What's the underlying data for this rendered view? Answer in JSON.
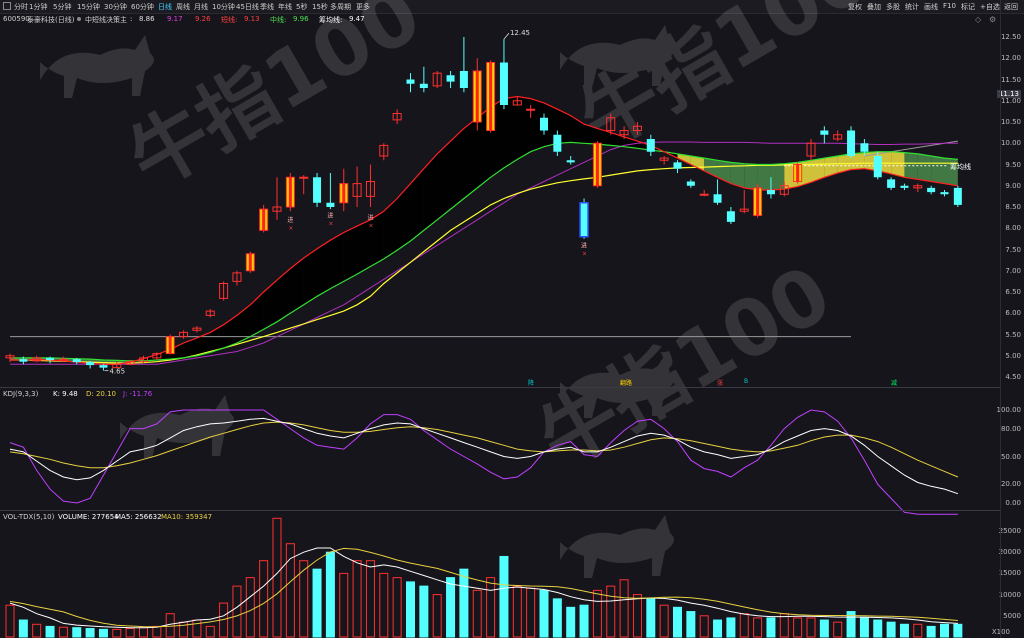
{
  "toolbar": {
    "left_icon": "panel-toggle-icon",
    "periods": [
      "分时",
      "1分钟",
      "5分钟",
      "15分钟",
      "30分钟",
      "60分钟",
      "日线",
      "周线",
      "月线",
      "10分钟",
      "45日线",
      "季线",
      "年线",
      "5秒",
      "15秒",
      "多周期",
      "更多"
    ],
    "active_period": "日线",
    "right_buttons": [
      "复权",
      "叠加",
      "多股",
      "统计",
      "画线",
      "F10",
      "标记",
      "+自选",
      "返回"
    ]
  },
  "stock": {
    "code": "600590",
    "name": "泰豪科技(日线)"
  },
  "indicator_main": {
    "name": "中短线决策主",
    "values": [
      {
        "label": ":",
        "value": "8.86",
        "color": "#e0e0e0"
      },
      {
        "label": "",
        "value": "9.17",
        "color": "#e040e0"
      },
      {
        "label": "",
        "value": "9.26",
        "color": "#ff4040"
      },
      {
        "label": "短线:",
        "value": "9.13",
        "color": "#ff4040"
      },
      {
        "label": "中线:",
        "value": "9.96",
        "color": "#50e050"
      },
      {
        "label": "筹均线:",
        "value": "9.47",
        "color": "#ffffff"
      }
    ]
  },
  "price_axis": [
    "12.50",
    "12.00",
    "11.50",
    "11.00",
    "10.50",
    "10.00",
    "9.50",
    "9.00",
    "8.50",
    "8.00",
    "7.50",
    "7.00",
    "6.50",
    "6.00",
    "5.50",
    "5.00",
    "4.50"
  ],
  "current_price_tag": "11.13",
  "high_label": "12.45",
  "low_label": "4.65",
  "line_label": "筹均线",
  "signals": [
    {
      "text": "降",
      "color": "#00c8c8"
    },
    {
      "text": "翻路",
      "color": "#ffcc00"
    },
    {
      "text": "涨",
      "color": "#ff4040"
    },
    {
      "text": "B",
      "color": "#00c8c8"
    },
    {
      "text": "减",
      "color": "#00ff60"
    }
  ],
  "candle_markers": [
    "进",
    "进",
    "进",
    "进"
  ],
  "kdj": {
    "name": "KDJ(9,3,3)",
    "k": "K: 9.48",
    "d": "D: 20.10",
    "j": "J: -11.76",
    "axis": [
      "100.00",
      "80.00",
      "50.00",
      "20.00",
      "0.00"
    ]
  },
  "volume": {
    "name": "VOL-TDX(5,10)",
    "vol": "VOLUME: 277654",
    "ma5": "MA5: 256632",
    "ma10": "MA10: 359347",
    "axis": [
      "25000",
      "20000",
      "15000",
      "10000",
      "5000"
    ],
    "unit": "X100"
  },
  "watermark": {
    "text": "牛指100",
    "icon": "bull-silhouette-icon"
  },
  "colors": {
    "up": "#ff3030",
    "down": "#54ffff",
    "k_line": "#ffffff",
    "d_line": "#e8d040",
    "j_line": "#c040ff",
    "ma5": "#ffffff",
    "ma10": "#e8d040"
  },
  "chart_data": {
    "type": "candlestick",
    "y_unit": "CNY",
    "ylim": [
      4.5,
      12.5
    ],
    "candles": [
      [
        4.95,
        5.0,
        5.05,
        4.85
      ],
      [
        4.92,
        4.86,
        4.98,
        4.8
      ],
      [
        4.88,
        4.95,
        5.0,
        4.85
      ],
      [
        4.95,
        4.9,
        4.98,
        4.82
      ],
      [
        4.9,
        4.92,
        4.98,
        4.85
      ],
      [
        4.92,
        4.85,
        4.95,
        4.8
      ],
      [
        4.85,
        4.78,
        4.88,
        4.7
      ],
      [
        4.78,
        4.72,
        4.8,
        4.65
      ],
      [
        4.72,
        4.8,
        4.85,
        4.7
      ],
      [
        4.8,
        4.86,
        4.9,
        4.78
      ],
      [
        4.86,
        4.95,
        5.0,
        4.82
      ],
      [
        4.95,
        5.05,
        5.08,
        4.9
      ],
      [
        5.05,
        5.45,
        5.5,
        5.05
      ],
      [
        5.45,
        5.55,
        5.6,
        5.4
      ],
      [
        5.6,
        5.65,
        5.7,
        5.55
      ],
      [
        5.95,
        6.05,
        6.1,
        5.9
      ],
      [
        6.35,
        6.7,
        6.75,
        6.3
      ],
      [
        6.75,
        6.95,
        7.0,
        6.65
      ],
      [
        7.0,
        7.4,
        7.45,
        6.95
      ],
      [
        7.95,
        8.45,
        8.55,
        7.9
      ],
      [
        8.4,
        8.5,
        9.2,
        8.2
      ],
      [
        8.5,
        9.2,
        9.3,
        8.4
      ],
      [
        9.2,
        9.2,
        9.25,
        8.8
      ],
      [
        9.2,
        8.6,
        9.3,
        8.5
      ],
      [
        8.6,
        8.5,
        9.3,
        8.45
      ],
      [
        8.6,
        9.05,
        9.4,
        8.4
      ],
      [
        8.75,
        9.05,
        9.45,
        8.5
      ],
      [
        8.75,
        9.1,
        9.5,
        8.5
      ],
      [
        9.7,
        9.95,
        10.0,
        9.6
      ],
      [
        10.55,
        10.7,
        10.8,
        10.45
      ],
      [
        11.5,
        11.4,
        11.65,
        11.2
      ],
      [
        11.4,
        11.3,
        11.8,
        11.2
      ],
      [
        11.35,
        11.65,
        11.7,
        11.3
      ],
      [
        11.6,
        11.45,
        11.7,
        11.3
      ],
      [
        11.7,
        11.3,
        12.5,
        11.2
      ],
      [
        10.5,
        11.7,
        12.0,
        10.3
      ],
      [
        10.3,
        11.9,
        11.95,
        10.25
      ],
      [
        11.9,
        10.9,
        12.45,
        10.8
      ],
      [
        10.9,
        11.0,
        11.1,
        10.9
      ],
      [
        10.8,
        10.8,
        10.9,
        10.6
      ],
      [
        10.6,
        10.3,
        10.7,
        10.2
      ],
      [
        10.2,
        9.8,
        10.3,
        9.7
      ],
      [
        9.6,
        9.55,
        9.7,
        9.5
      ],
      [
        8.6,
        7.8,
        8.7,
        7.75
      ],
      [
        9.0,
        10.0,
        10.05,
        8.95
      ],
      [
        10.3,
        10.6,
        10.7,
        10.2
      ],
      [
        10.2,
        10.3,
        10.4,
        10.1
      ],
      [
        10.3,
        10.4,
        10.5,
        10.2
      ],
      [
        10.1,
        9.8,
        10.2,
        9.7
      ],
      [
        9.6,
        9.65,
        9.7,
        9.5
      ],
      [
        9.55,
        9.4,
        9.6,
        9.3
      ],
      [
        9.1,
        9.0,
        9.15,
        8.95
      ],
      [
        8.8,
        8.8,
        8.9,
        8.75
      ],
      [
        8.8,
        8.6,
        9.15,
        8.55
      ],
      [
        8.4,
        8.15,
        8.5,
        8.1
      ],
      [
        8.4,
        8.45,
        8.9,
        8.35
      ],
      [
        8.3,
        8.95,
        9.05,
        8.25
      ],
      [
        8.9,
        8.8,
        9.2,
        8.7
      ],
      [
        8.8,
        9.0,
        9.1,
        8.75
      ],
      [
        9.1,
        9.5,
        9.55,
        9.05
      ],
      [
        9.7,
        10.0,
        10.1,
        9.6
      ],
      [
        10.3,
        10.2,
        10.4,
        10.0
      ],
      [
        10.1,
        10.2,
        10.3,
        10.05
      ],
      [
        10.3,
        9.7,
        10.4,
        9.65
      ],
      [
        10.0,
        9.8,
        10.1,
        9.7
      ],
      [
        9.7,
        9.2,
        9.8,
        9.15
      ],
      [
        9.15,
        8.95,
        9.2,
        8.9
      ],
      [
        9.0,
        8.95,
        9.05,
        8.9
      ],
      [
        8.95,
        9.0,
        9.05,
        8.85
      ],
      [
        8.95,
        8.85,
        9.0,
        8.8
      ],
      [
        8.85,
        8.8,
        8.9,
        8.75
      ],
      [
        8.95,
        8.55,
        9.0,
        8.5
      ]
    ],
    "series": [
      {
        "name": "短线",
        "values": [
          4.9,
          4.9,
          4.91,
          4.9,
          4.88,
          4.85,
          4.82,
          4.8,
          4.8,
          4.85,
          4.93,
          5.03,
          5.15,
          5.3,
          5.42,
          5.55,
          5.73,
          5.95,
          6.2,
          6.5,
          6.78,
          7.05,
          7.3,
          7.52,
          7.72,
          7.9,
          8.05,
          8.2,
          8.4,
          8.7,
          9.05,
          9.4,
          9.75,
          10.05,
          10.35,
          10.6,
          10.85,
          11.05,
          11.1,
          11.05,
          10.95,
          10.8,
          10.65,
          10.45,
          10.35,
          10.25,
          10.15,
          10.05,
          9.95,
          9.8,
          9.65,
          9.5,
          9.35,
          9.2,
          9.05,
          8.95,
          8.9,
          8.9,
          8.92,
          8.98,
          9.08,
          9.2,
          9.3,
          9.38,
          9.4,
          9.35,
          9.28,
          9.2,
          9.15,
          9.1,
          9.05,
          9.0
        ]
      },
      {
        "name": "中线",
        "values": [
          4.95,
          4.95,
          4.95,
          4.95,
          4.94,
          4.93,
          4.92,
          4.9,
          4.89,
          4.88,
          4.88,
          4.9,
          4.92,
          4.95,
          5.0,
          5.08,
          5.18,
          5.3,
          5.45,
          5.62,
          5.8,
          6.0,
          6.2,
          6.4,
          6.58,
          6.75,
          6.92,
          7.1,
          7.28,
          7.48,
          7.7,
          7.95,
          8.2,
          8.45,
          8.7,
          8.95,
          9.2,
          9.42,
          9.62,
          9.8,
          9.92,
          10.0,
          10.02,
          10.0,
          9.98,
          9.95,
          9.92,
          9.88,
          9.84,
          9.8,
          9.75,
          9.7,
          9.65,
          9.6,
          9.55,
          9.52,
          9.5,
          9.5,
          9.52,
          9.55,
          9.6,
          9.65,
          9.7,
          9.75,
          9.78,
          9.8,
          9.8,
          9.78,
          9.75,
          9.7,
          9.65,
          9.62
        ]
      },
      {
        "name": "黄线",
        "values": [
          4.9,
          4.9,
          4.89,
          4.88,
          4.87,
          4.86,
          4.85,
          4.84,
          4.83,
          4.83,
          4.84,
          4.86,
          4.9,
          4.95,
          5.02,
          5.1,
          5.18,
          5.27,
          5.36,
          5.45,
          5.55,
          5.65,
          5.75,
          5.85,
          5.95,
          6.05,
          6.2,
          6.4,
          6.7,
          6.95,
          7.2,
          7.45,
          7.7,
          7.95,
          8.15,
          8.35,
          8.55,
          8.7,
          8.82,
          8.92,
          9.0,
          9.07,
          9.12,
          9.16,
          9.2,
          9.25,
          9.3,
          9.35,
          9.38,
          9.4,
          9.42,
          9.43,
          9.44,
          9.45,
          9.46,
          9.47,
          9.48,
          9.48,
          9.49,
          9.5,
          9.5,
          9.51,
          9.52,
          9.52,
          9.53,
          9.53,
          9.53,
          9.53,
          9.53,
          9.53,
          9.53,
          9.53
        ]
      },
      {
        "name": "紫线",
        "values": [
          4.8,
          4.8,
          4.8,
          4.8,
          4.8,
          4.8,
          4.8,
          4.8,
          4.8,
          4.8,
          4.8,
          4.8,
          4.85,
          4.9,
          4.95,
          5.0,
          5.05,
          5.1,
          5.2,
          5.3,
          5.45,
          5.6,
          5.75,
          5.9,
          6.05,
          6.2,
          6.4,
          6.6,
          6.8,
          7.0,
          7.2,
          7.4,
          7.6,
          7.8,
          8.0,
          8.2,
          8.4,
          8.6,
          8.8,
          8.95,
          9.1,
          9.25,
          9.4,
          9.55,
          9.7,
          9.85,
          9.95,
          10.0,
          10.02,
          10.03,
          10.03,
          10.03,
          10.02,
          10.02,
          10.02,
          10.02,
          10.01,
          10.0,
          10.0,
          10.0,
          10.0,
          10.0,
          10.0,
          9.99,
          9.98,
          9.97,
          9.97,
          9.98,
          9.98,
          9.99,
          10.0,
          10.0
        ]
      },
      {
        "name": "灰线",
        "values": [
          5.45,
          5.45,
          5.45,
          5.45,
          5.45,
          5.45,
          5.45,
          5.45,
          5.45,
          5.45,
          5.45,
          5.45,
          5.45,
          5.45,
          5.45,
          5.45,
          5.45,
          5.45,
          5.45,
          5.45,
          5.45,
          5.45,
          5.45,
          5.45,
          5.45,
          5.45,
          5.45,
          5.45,
          5.45,
          5.45,
          5.45,
          5.45,
          5.45,
          5.45,
          5.45,
          5.45,
          5.45,
          5.45,
          5.45,
          5.45,
          5.45,
          5.45,
          5.45,
          5.45,
          5.45,
          5.45,
          5.45,
          5.45,
          5.45,
          5.45,
          5.45,
          5.45,
          5.45,
          5.45,
          5.45,
          5.45,
          5.45,
          5.45,
          5.45,
          5.45,
          5.45,
          5.45,
          5.45,
          5.45,
          9.7,
          9.75,
          9.8,
          9.85,
          9.9,
          9.95,
          10.0,
          10.05
        ]
      }
    ],
    "kdj_series": [
      {
        "name": "K",
        "values": [
          58,
          55,
          45,
          35,
          28,
          25,
          27,
          35,
          45,
          55,
          58,
          62,
          70,
          78,
          82,
          85,
          86,
          88,
          90,
          91,
          88,
          85,
          80,
          75,
          72,
          70,
          75,
          80,
          84,
          86,
          85,
          80,
          75,
          70,
          65,
          60,
          55,
          50,
          48,
          50,
          55,
          58,
          60,
          55,
          55,
          60,
          66,
          72,
          75,
          73,
          68,
          60,
          55,
          52,
          48,
          50,
          52,
          58,
          66,
          72,
          78,
          80,
          78,
          72,
          62,
          50,
          40,
          30,
          22,
          18,
          15,
          10
        ]
      },
      {
        "name": "D",
        "values": [
          55,
          53,
          50,
          47,
          43,
          40,
          38,
          38,
          40,
          43,
          47,
          51,
          56,
          61,
          66,
          71,
          75,
          79,
          83,
          86,
          87,
          86,
          84,
          81,
          78,
          76,
          76,
          77,
          79,
          81,
          82,
          81,
          79,
          76,
          73,
          70,
          66,
          62,
          58,
          56,
          55,
          56,
          57,
          57,
          56,
          57,
          60,
          64,
          68,
          70,
          69,
          67,
          64,
          61,
          58,
          56,
          55,
          56,
          59,
          62,
          67,
          71,
          73,
          73,
          70,
          66,
          60,
          53,
          46,
          40,
          34,
          28
        ]
      },
      {
        "name": "J",
        "values": [
          65,
          60,
          35,
          15,
          2,
          0,
          5,
          30,
          55,
          80,
          80,
          85,
          98,
          100,
          100,
          100,
          100,
          100,
          100,
          100,
          90,
          80,
          70,
          62,
          60,
          58,
          70,
          85,
          95,
          95,
          90,
          78,
          68,
          58,
          50,
          42,
          33,
          26,
          28,
          38,
          55,
          62,
          66,
          52,
          50,
          65,
          78,
          88,
          90,
          80,
          66,
          46,
          37,
          34,
          28,
          38,
          46,
          62,
          80,
          92,
          100,
          98,
          88,
          70,
          46,
          20,
          5,
          -10,
          -20,
          -20,
          -20,
          -20
        ]
      }
    ],
    "volume_values": [
      7500,
      4000,
      3000,
      2500,
      2300,
      2200,
      2000,
      1800,
      1800,
      2000,
      2200,
      2500,
      5500,
      3500,
      4000,
      2500,
      8000,
      12000,
      14000,
      18000,
      28000,
      22000,
      18000,
      16000,
      20000,
      15000,
      18000,
      18000,
      15000,
      14000,
      13000,
      12000,
      10000,
      14000,
      16000,
      11000,
      14000,
      19000,
      12000,
      11500,
      11000,
      9000,
      7000,
      7500,
      11000,
      12000,
      13500,
      10000,
      9000,
      7500,
      7000,
      6000,
      5000,
      4000,
      4500,
      5500,
      4500,
      4500,
      5500,
      4500,
      4500,
      4000,
      3500,
      6000,
      4500,
      4000,
      3500,
      3000,
      3000,
      2500,
      3000,
      3000
    ],
    "ma5_series": [
      8000,
      7000,
      5500,
      4500,
      3200,
      2800,
      2600,
      2400,
      2300,
      2200,
      2200,
      2300,
      3000,
      3500,
      4000,
      4200,
      5000,
      7000,
      9500,
      12000,
      15000,
      18500,
      20000,
      21000,
      21000,
      19000,
      17500,
      16500,
      17000,
      16500,
      15500,
      14500,
      13500,
      12500,
      12000,
      11500,
      11000,
      11500,
      11800,
      11500,
      11200,
      10500,
      9500,
      8800,
      8400,
      8500,
      8800,
      9000,
      9200,
      9100,
      8700,
      8000,
      7500,
      6800,
      6000,
      5400,
      5000,
      4800,
      4800,
      4900,
      4900,
      4800,
      4700,
      4700,
      4700,
      4600,
      4500,
      4300,
      4000,
      3600,
      3400,
      3200
    ]
  }
}
